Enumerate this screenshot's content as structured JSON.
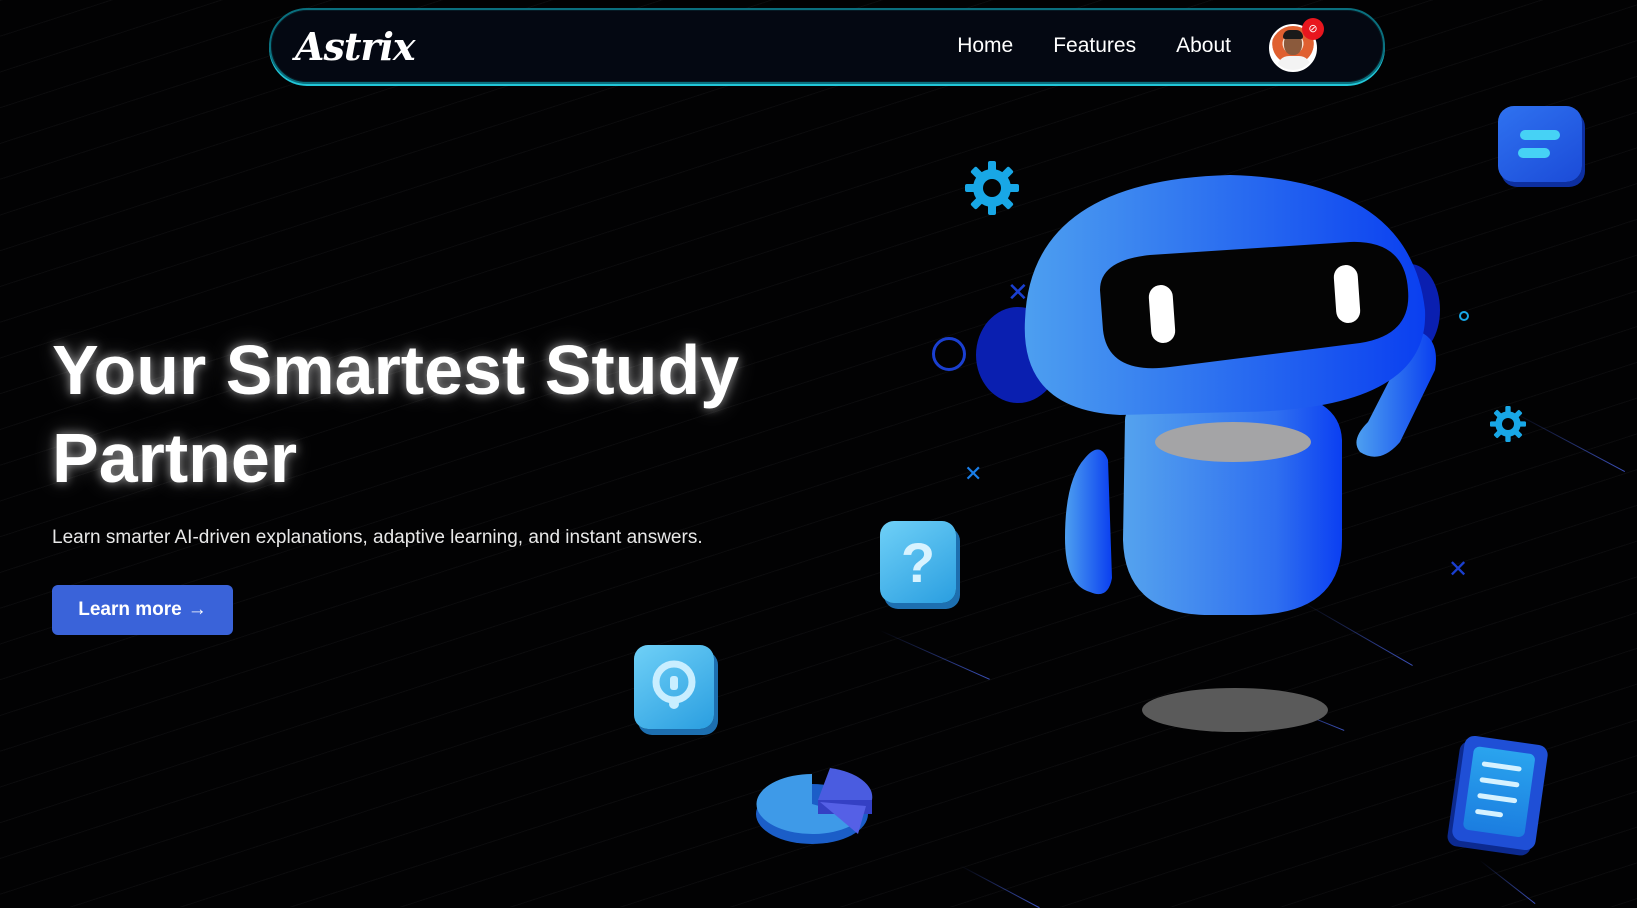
{
  "nav": {
    "logo": "Astrix",
    "links": [
      "Home",
      "Features",
      "About"
    ],
    "notification_icon": "notification-badge-icon"
  },
  "hero": {
    "title": "Your Smartest Study Partner",
    "subtitle": "Learn smarter AI-driven explanations, adaptive learning, and instant answers.",
    "cta_label": "Learn more",
    "cta_arrow": "→"
  },
  "colors": {
    "accent": "#3a63d9",
    "nav_border": "#22c7d8",
    "robot_blue": "#1f5ff0",
    "badge_red": "#e8161e"
  },
  "illustration": {
    "question_glyph": "?",
    "icons": [
      "robot-icon",
      "gear-icon",
      "question-box-icon",
      "pie-chart-icon",
      "document-icon",
      "chat-bubble-icon"
    ]
  }
}
